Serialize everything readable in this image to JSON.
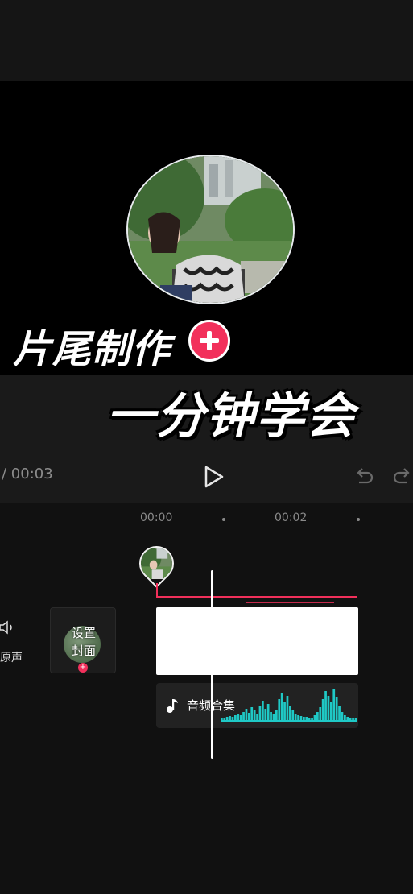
{
  "overlay": {
    "headline": "片尾制作",
    "subheadline": "一分钟学会"
  },
  "player": {
    "timecode": "/ 00:03"
  },
  "timeline": {
    "ruler_labels": [
      "00:00",
      "00:02"
    ]
  },
  "tracks": {
    "original_sound_label": "原声",
    "cover_label_line1": "设置",
    "cover_label_line2": "封面",
    "audio_clip_label": "音频合集"
  },
  "colors": {
    "accent": "#f2305b",
    "waveform": "#1fc9c6",
    "timeline_bg": "#111111"
  },
  "icons": [
    "plus-icon",
    "play-icon",
    "undo-icon",
    "redo-icon",
    "speaker-icon",
    "music-note-icon"
  ]
}
